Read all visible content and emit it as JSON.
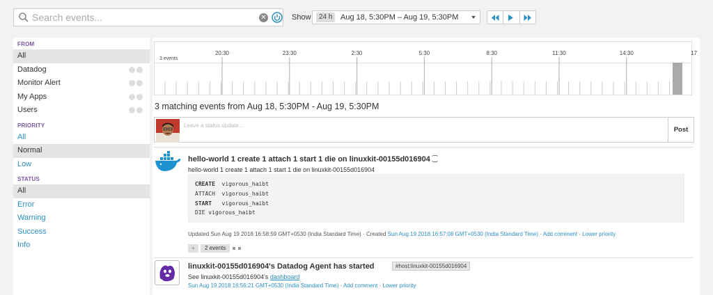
{
  "search": {
    "placeholder": "Search events..."
  },
  "toolbar": {
    "show_label": "Show",
    "range_chip": "24 h",
    "range_text": "Aug 18, 5:30PM – Aug 19, 5:30PM"
  },
  "sidebar": {
    "from": {
      "header": "FROM",
      "items": [
        {
          "label": "All"
        },
        {
          "label": "Datadog"
        },
        {
          "label": "Monitor Alert"
        },
        {
          "label": "My Apps"
        },
        {
          "label": "Users"
        }
      ]
    },
    "priority": {
      "header": "PRIORITY",
      "items": [
        {
          "label": "All"
        },
        {
          "label": "Normal"
        },
        {
          "label": "Low"
        }
      ]
    },
    "status": {
      "header": "STATUS",
      "items": [
        {
          "label": "All"
        },
        {
          "label": "Error"
        },
        {
          "label": "Warning"
        },
        {
          "label": "Success"
        },
        {
          "label": "Info"
        }
      ]
    }
  },
  "timeline": {
    "count_label": "3 events",
    "ticks": [
      "20:30",
      "23:30",
      "2:30",
      "5:30",
      "8:30",
      "11:30",
      "14:30",
      "17"
    ]
  },
  "feed": {
    "heading": "3 matching events from Aug 18, 5:30PM - Aug 19, 5:30PM",
    "status_placeholder": "Leave a status update...",
    "post_label": "Post"
  },
  "event1": {
    "title": "hello-world 1 create 1 attach 1 start 1 die on linuxkit-00155d016904",
    "subtitle": "hello-world 1 create 1 attach 1 start 1 die on linuxkit-00155d016904",
    "code": [
      {
        "k": "CREATE",
        "v": "vigorous_haibt"
      },
      {
        "k": "ATTACH",
        "v": "vigorous_haibt"
      },
      {
        "k": "START",
        "v": "vigorous_haibt"
      },
      {
        "k": "DIE",
        "v": "vigorous_haibt"
      }
    ],
    "updated": "Updated Sun Aug 19 2018 16:58:59 GMT+0530 (India Standard Time)",
    "created_label": "Created",
    "created_time": "Sun Aug 19 2018 16:57:08 GMT+0530 (India Standard Time)",
    "add_comment": "Add comment",
    "lower_priority": "Lower priority",
    "expand_count": "2 events"
  },
  "event2": {
    "title": "linuxkit-00155d016904's Datadog Agent has started",
    "tag": "#host:linuxkit-00155d016904",
    "subtitle_prefix": "See linuxkit-00155d016904's",
    "subtitle_link": "dashboard",
    "time": "Sun Aug 19 2018 16:56:21 GMT+0530 (India Standard Time)",
    "add_comment": "Add comment",
    "lower_priority": "Lower priority"
  },
  "colors": {
    "accent": "#2a8fc4",
    "section_header": "#7b57a8"
  }
}
